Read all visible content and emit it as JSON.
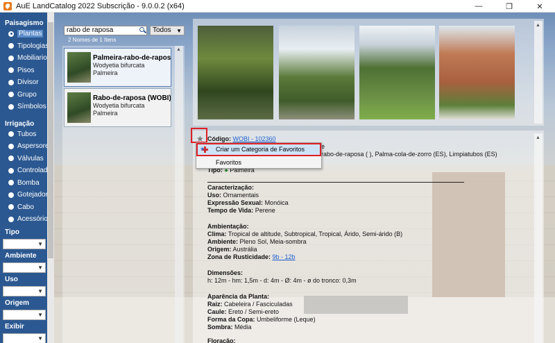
{
  "window": {
    "title": "AuE LandCatalog 2022 Subscrição - 9.0.0.2 (x64)",
    "minimize": "—",
    "maximize": "❐",
    "close": "✕"
  },
  "sidebar": {
    "landscaping_header": "Paisagismo",
    "landscaping_items": [
      {
        "label": "Plantas",
        "selected": true
      },
      {
        "label": "Tipologias"
      },
      {
        "label": "Mobiliarios"
      },
      {
        "label": "Pisos"
      },
      {
        "label": "Divisor"
      },
      {
        "label": "Grupo"
      },
      {
        "label": "Símbolos"
      }
    ],
    "irrigation_header": "Irrigação",
    "irrigation_items": [
      {
        "label": "Tubos"
      },
      {
        "label": "Aspersores"
      },
      {
        "label": "Válvulas"
      },
      {
        "label": "Controlado"
      },
      {
        "label": "Bomba"
      },
      {
        "label": "Gotejador"
      },
      {
        "label": "Cabo"
      },
      {
        "label": "Acessórios"
      }
    ],
    "filters": [
      {
        "label": "Tipo"
      },
      {
        "label": "Ambiente"
      },
      {
        "label": "Uso"
      },
      {
        "label": "Origem"
      },
      {
        "label": "Exibir"
      }
    ]
  },
  "search": {
    "query": "rabo de raposa",
    "filter": "Todos",
    "result_count": "2 Nomes de 1 Itens"
  },
  "results": [
    {
      "name": "Palmeira-rabo-de-raposa (",
      "scientific": "Wodyetia bifurcata",
      "type": "Palmeira"
    },
    {
      "name": "Rabo-de-raposa (WOBI)",
      "scientific": "Wodyetia bifurcata",
      "type": "Palmeira"
    }
  ],
  "detail": {
    "code_label": "Código:",
    "code_value": "WOBI - 102360",
    "names_tail": "rabo-de-raposa ( ), Palma-cola-de-zorro (ES), Limpiatubos (ES)",
    "name_suffix": "e",
    "type_label": "Tipo:",
    "type_value": "Palmeira",
    "characterization": "Caracterização:",
    "use_label": "Uso:",
    "use_value": "Ornamentais",
    "sexual_label": "Expressão Sexual:",
    "sexual_value": "Monóica",
    "life_label": "Tempo de Vida:",
    "life_value": "Perene",
    "ambientation": "Ambientação:",
    "climate_label": "Clima:",
    "climate_value": "Tropical de altitude, Subtropical, Tropical, Árido, Semi-árido (B)",
    "env_label": "Ambiente:",
    "env_value": "Pleno Sol, Meia-sombra",
    "origin_label": "Origem:",
    "origin_value": "Austrália",
    "zone_label": "Zona de Rusticidade:",
    "zone_value": "9b - 12b",
    "dimensions": "Dimensões:",
    "dimensions_value": "h: 12m - hm: 1,5m - d: 4m - Ø: 4m - ø do tronco: 0,3m",
    "appearance": "Aparência da Planta:",
    "root_label": "Raiz:",
    "root_value": "Cabeleira / Fasciculadas",
    "stem_label": "Caule:",
    "stem_value": "Ereto / Semi-ereto",
    "crown_label": "Forma da Copa:",
    "crown_value": "Umbeliforme (Leque)",
    "shade_label": "Sombra:",
    "shade_value": "Média",
    "flowering": "Floração:"
  },
  "context_menu": {
    "items": [
      "Criar um Categoria de Favoritos",
      "Favoritos"
    ]
  },
  "colors": {
    "sidebar": "#2b5891",
    "highlight": "#e01e26",
    "link": "#1c5fd0"
  }
}
